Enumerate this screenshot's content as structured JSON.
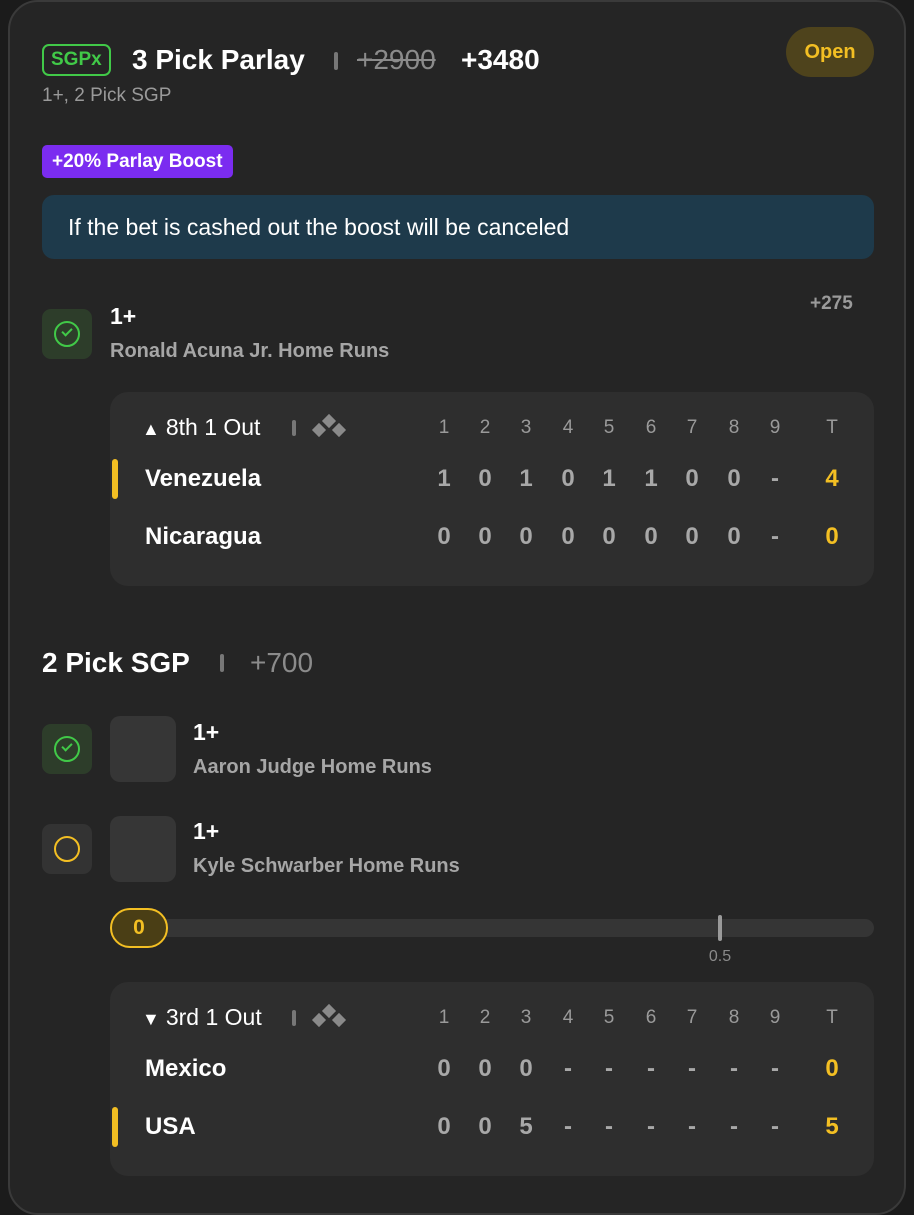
{
  "header": {
    "badge": "SGPx",
    "title": "3 Pick Parlay",
    "old_odds": "+2900",
    "new_odds": "+3480",
    "subtitle": "1+, 2 Pick SGP",
    "status": "Open"
  },
  "boost": {
    "tag": "+20% Parlay Boost",
    "note": "If the bet is cashed out the boost will be canceled"
  },
  "leg1": {
    "line": "1+",
    "market": "Ronald Acuna Jr. Home Runs",
    "odds": "+275",
    "state": "won"
  },
  "game1": {
    "status": "8th 1 Out",
    "status_arrow": "▲",
    "innings": [
      "1",
      "2",
      "3",
      "4",
      "5",
      "6",
      "7",
      "8",
      "9"
    ],
    "total_label": "T",
    "teams": [
      {
        "name": "Venezuela",
        "scores": [
          "1",
          "0",
          "1",
          "0",
          "1",
          "1",
          "0",
          "0",
          "-"
        ],
        "total": "4",
        "batting": true
      },
      {
        "name": "Nicaragua",
        "scores": [
          "0",
          "0",
          "0",
          "0",
          "0",
          "0",
          "0",
          "0",
          "-"
        ],
        "total": "0",
        "batting": false
      }
    ]
  },
  "sgp": {
    "title": "2 Pick SGP",
    "odds": "+700",
    "legs": [
      {
        "line": "1+",
        "market": "Aaron Judge Home Runs",
        "state": "won"
      },
      {
        "line": "1+",
        "market": "Kyle Schwarber Home Runs",
        "state": "pending"
      }
    ],
    "progress": {
      "current": "0",
      "target_label": "0.5",
      "target_fraction": 0.5
    }
  },
  "game2": {
    "status": "3rd 1 Out",
    "status_arrow": "▼",
    "innings": [
      "1",
      "2",
      "3",
      "4",
      "5",
      "6",
      "7",
      "8",
      "9"
    ],
    "total_label": "T",
    "teams": [
      {
        "name": "Mexico",
        "scores": [
          "0",
          "0",
          "0",
          "-",
          "-",
          "-",
          "-",
          "-",
          "-"
        ],
        "total": "0",
        "batting": false
      },
      {
        "name": "USA",
        "scores": [
          "0",
          "0",
          "5",
          "-",
          "-",
          "-",
          "-",
          "-",
          "-"
        ],
        "total": "5",
        "batting": true
      }
    ]
  },
  "colors": {
    "accent_yellow": "#f3bf23",
    "win_green": "#41c948",
    "boost_purple": "#7b2cf0",
    "info_blue": "#1e3a4b"
  }
}
